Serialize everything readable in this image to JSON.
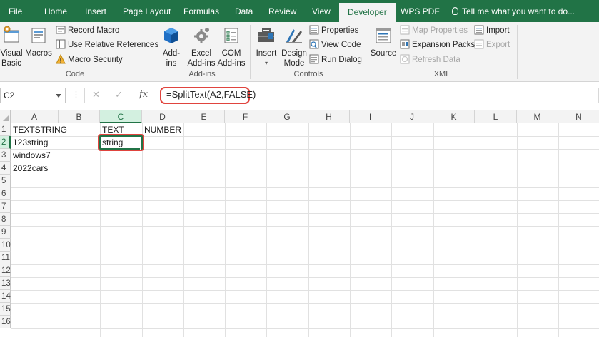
{
  "tabs": [
    {
      "label": "File"
    },
    {
      "label": "Home"
    },
    {
      "label": "Insert"
    },
    {
      "label": "Page Layout"
    },
    {
      "label": "Formulas"
    },
    {
      "label": "Data"
    },
    {
      "label": "Review"
    },
    {
      "label": "View"
    },
    {
      "label": "Developer"
    },
    {
      "label": "WPS PDF"
    }
  ],
  "active_tab": "Developer",
  "tell_me": "Tell me what you want to do...",
  "ribbon": {
    "code": {
      "label": "Code",
      "visual_basic_1": "Visual",
      "visual_basic_2": "Basic",
      "macros": "Macros",
      "record_macro": "Record Macro",
      "use_relative": "Use Relative References",
      "macro_security": "Macro Security"
    },
    "addins": {
      "label": "Add-ins",
      "addins_1": "Add-",
      "addins_2": "ins",
      "excel_addins_1": "Excel",
      "excel_addins_2": "Add-ins",
      "com_addins_1": "COM",
      "com_addins_2": "Add-ins"
    },
    "controls": {
      "label": "Controls",
      "insert": "Insert",
      "design_mode_1": "Design",
      "design_mode_2": "Mode",
      "properties": "Properties",
      "view_code": "View Code",
      "run_dialog": "Run Dialog"
    },
    "xml": {
      "label": "XML",
      "source": "Source",
      "map_properties": "Map Properties",
      "expansion_packs": "Expansion Packs",
      "refresh_data": "Refresh Data",
      "import": "Import",
      "export": "Export"
    }
  },
  "formula_bar": {
    "name_box": "C2",
    "fx": "fx",
    "formula": "=SplitText(A2,FALSE)"
  },
  "columns": [
    "A",
    "B",
    "C",
    "D",
    "E",
    "F",
    "G",
    "H",
    "I",
    "J",
    "K",
    "L",
    "M",
    "N"
  ],
  "rows": [
    "1",
    "2",
    "3",
    "4",
    "5",
    "6",
    "7",
    "8",
    "9",
    "10",
    "11",
    "12",
    "13",
    "14",
    "15",
    "16"
  ],
  "cells": {
    "A1": "TEXTSTRING",
    "C1": "TEXT",
    "D1": "NUMBER",
    "A2": "123string",
    "C2": "string",
    "A3": "windows7",
    "A4": "2022cars"
  },
  "colors": {
    "excel_green": "#217346",
    "highlight_red": "#e0443e"
  }
}
